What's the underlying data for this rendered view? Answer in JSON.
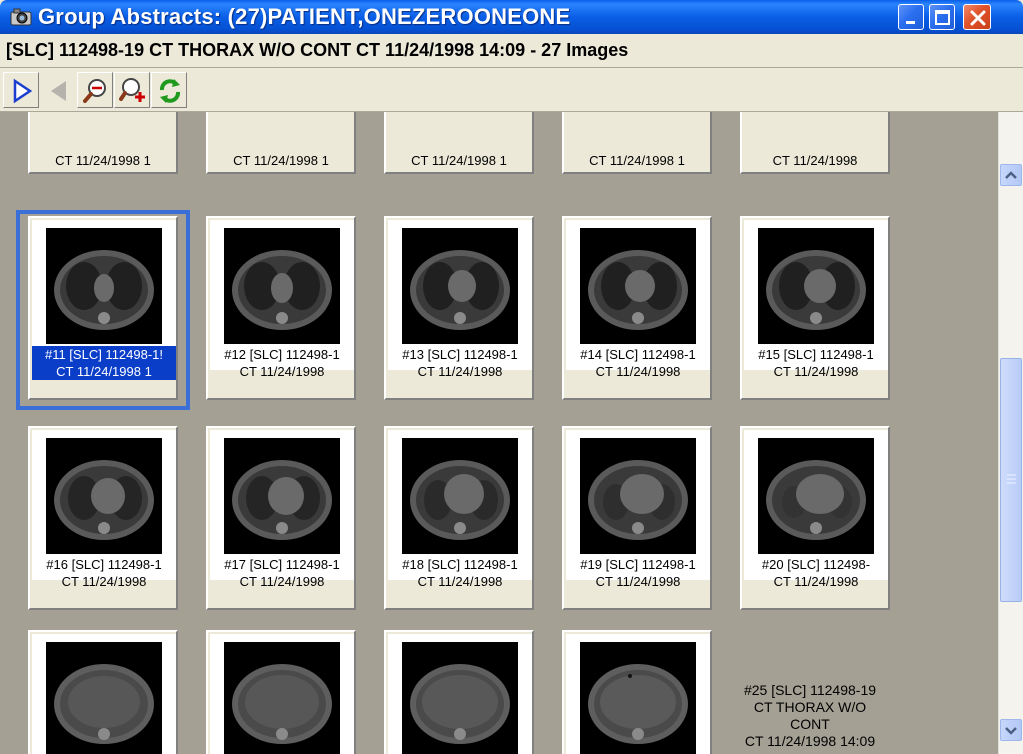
{
  "window": {
    "title": "Group Abstracts: (27)PATIENT,ONEZEROONEONE",
    "icon": "camera-icon",
    "buttons": [
      "minimize-icon",
      "maximize-icon",
      "close-icon"
    ]
  },
  "header": {
    "text": "[SLC] 112498-19  CT THORAX W/O CONT CT 11/24/1998 14:09  - 27  Images"
  },
  "toolbar": {
    "tools": [
      "play-next-icon",
      "previous-icon",
      "zoom-out-icon",
      "zoom-in-icon",
      "refresh-icon"
    ]
  },
  "grid": {
    "top_row_labels": [
      "CT 11/24/1998 1",
      "CT 11/24/1998 1",
      "CT 11/24/1998 1",
      "CT 11/24/1998 1",
      "CT 11/24/1998"
    ],
    "row2": [
      {
        "line1": "#11 [SLC] 112498-1!",
        "line2": "CT 11/24/1998 1",
        "selected": true
      },
      {
        "line1": "#12 [SLC] 112498-1",
        "line2": "CT 11/24/1998"
      },
      {
        "line1": "#13 [SLC] 112498-1",
        "line2": "CT 11/24/1998"
      },
      {
        "line1": "#14 [SLC] 112498-1",
        "line2": "CT 11/24/1998"
      },
      {
        "line1": "#15 [SLC] 112498-1",
        "line2": "CT 11/24/1998"
      }
    ],
    "row3": [
      {
        "line1": "#16 [SLC] 112498-1",
        "line2": "CT 11/24/1998"
      },
      {
        "line1": "#17 [SLC] 112498-1",
        "line2": "CT 11/24/1998"
      },
      {
        "line1": "#18 [SLC] 112498-1",
        "line2": "CT 11/24/1998"
      },
      {
        "line1": "#19 [SLC] 112498-1",
        "line2": "CT 11/24/1998"
      },
      {
        "line1": "#20 [SLC] 112498-",
        "line2": "CT 11/24/1998"
      }
    ],
    "item25": {
      "line1": "#25 [SLC] 112498-19",
      "line2": "CT THORAX W/O",
      "line3": "CONT",
      "line4": "CT 11/24/1998 14:09"
    }
  },
  "colors": {
    "titlebar": "#0a5ee8",
    "selection": "#0a3dc8",
    "grid_bg": "#a4a094"
  }
}
